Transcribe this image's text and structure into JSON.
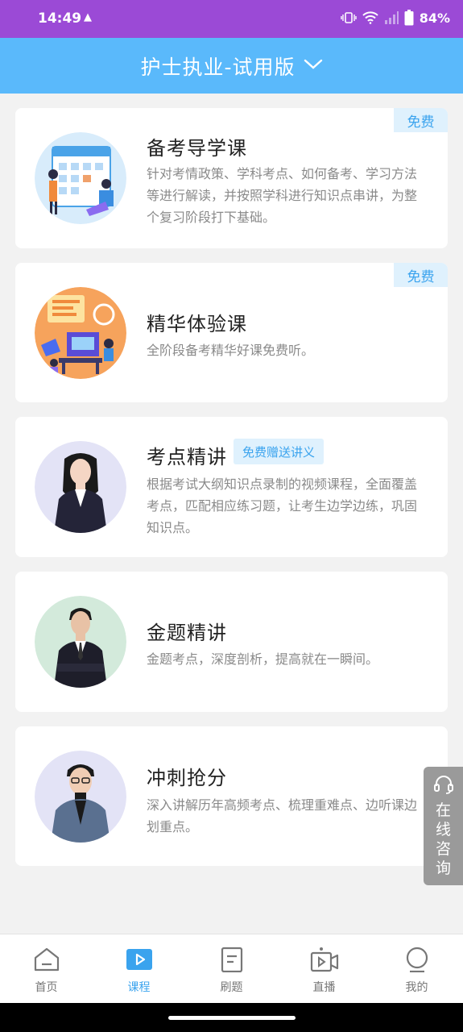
{
  "status_bar": {
    "time": "14:49",
    "battery": "84%"
  },
  "header": {
    "title": "护士执业-试用版",
    "dropdown_icon": "chevron-down-icon"
  },
  "courses": [
    {
      "title": "备考导学课",
      "tag": "免费",
      "description": "针对考情政策、学科考点、如何备考、学习方法等进行解读，并按照学科进行知识点串讲，为整个复习阶段打下基础。"
    },
    {
      "title": "精华体验课",
      "tag": "免费",
      "description": "全阶段备考精华好课免费听。"
    },
    {
      "title": "考点精讲",
      "badge": "免费赠送讲义",
      "description": "根据考试大纲知识点录制的视频课程，全面覆盖考点，匹配相应练习题，让考生边学边练，巩固知识点。"
    },
    {
      "title": "金题精讲",
      "description": "金题考点，深度剖析，提高就在一瞬间。"
    },
    {
      "title": "冲刺抢分",
      "description": "深入讲解历年高频考点、梳理重难点、边听课边划重点。"
    }
  ],
  "consult": {
    "label": "在线咨询",
    "icon": "headset-icon"
  },
  "bottom_nav": [
    {
      "label": "首页",
      "icon": "home-icon",
      "active": false
    },
    {
      "label": "课程",
      "icon": "play-icon",
      "active": true
    },
    {
      "label": "刷题",
      "icon": "document-icon",
      "active": false
    },
    {
      "label": "直播",
      "icon": "video-camera-icon",
      "active": false
    },
    {
      "label": "我的",
      "icon": "profile-icon",
      "active": false
    }
  ],
  "colors": {
    "status_bar": "#9b4ad6",
    "header": "#5ab9fb",
    "accent": "#3aa3ee",
    "tag_bg": "#dff1fd"
  }
}
